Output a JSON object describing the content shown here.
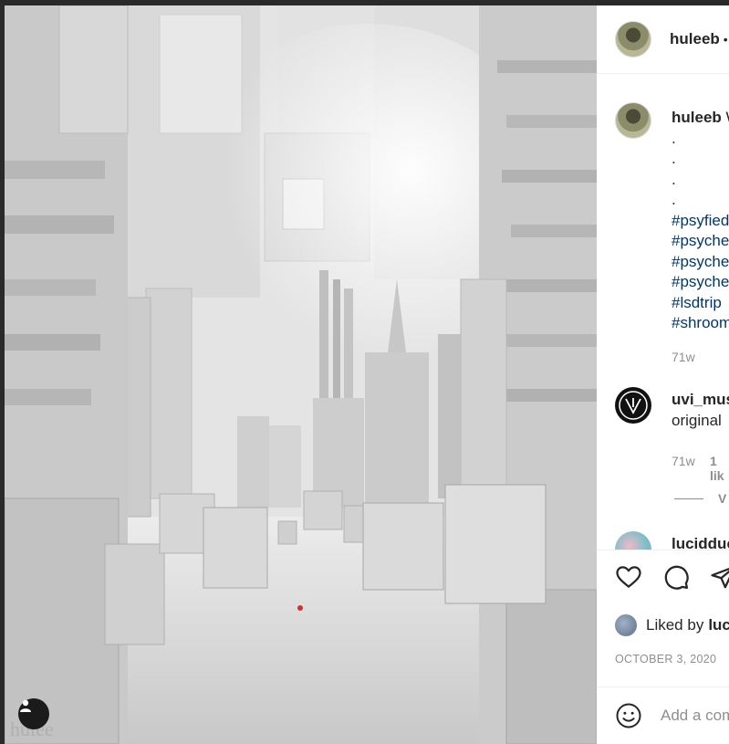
{
  "post": {
    "author": "huleeb",
    "separator": "•"
  },
  "caption": {
    "username": "huleeb",
    "text_start": "W",
    "dots": [
      ".",
      ".",
      ".",
      "."
    ],
    "hashtags": [
      "#psyfied",
      "#psyche",
      "#psyche",
      "#psyche",
      "#lsdtrip",
      "#shroom"
    ],
    "time": "71w"
  },
  "comments": [
    {
      "username": "uvi_mus",
      "text": "original",
      "time": "71w",
      "likes": "1 lik",
      "view_replies": "V"
    },
    {
      "username": "lucidduc"
    }
  ],
  "actions": {
    "liked_by_label": "Liked by",
    "liked_by_user": "luc",
    "date": "OCTOBER 3, 2020"
  },
  "add_comment": {
    "placeholder": "Add a comment..."
  },
  "icons": {
    "like": "heart-icon",
    "comment": "comment-icon",
    "share": "share-icon",
    "emoji": "emoji-icon",
    "tag": "user-tag-icon"
  }
}
